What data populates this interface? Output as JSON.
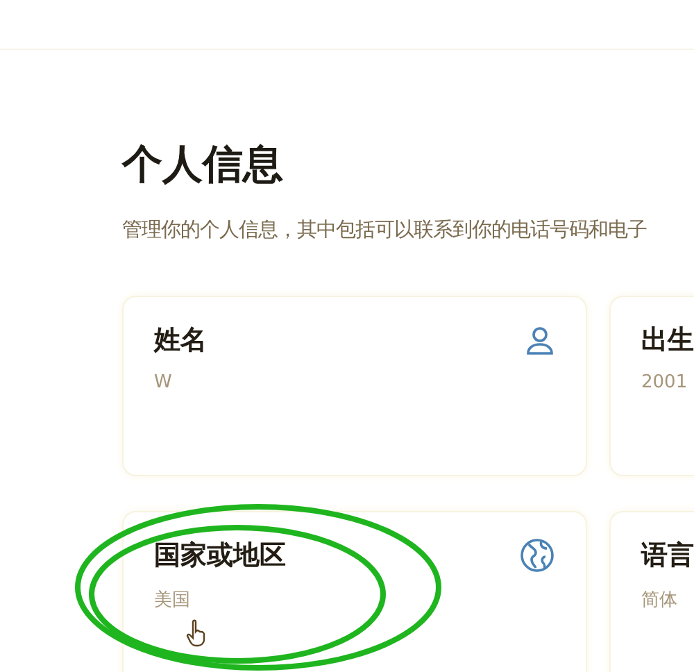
{
  "heading": "个人信息",
  "description": "管理你的个人信息，其中包括可以联系到你的电话号码和电子",
  "cards": [
    {
      "title": "姓名",
      "value": "W",
      "kind": "person",
      "circled": false
    },
    {
      "title": "出生",
      "value": "2001",
      "kind": "plain",
      "circled": false
    },
    {
      "title": "国家或地区",
      "value": "美国",
      "kind": "globe",
      "circled": true
    },
    {
      "title": "语言",
      "value": "简体",
      "kind": "plain",
      "circled": false
    }
  ]
}
